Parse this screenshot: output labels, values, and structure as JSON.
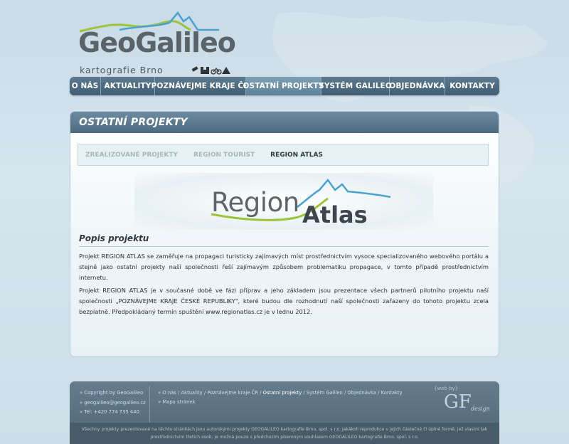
{
  "logo": {
    "name": "GeoGalileo",
    "subtitle": "kartografie Brno"
  },
  "nav": {
    "items": [
      {
        "label": "O NÁS"
      },
      {
        "label": "AKTUALITY"
      },
      {
        "label": "POZNÁVEJME KRAJE ČR"
      },
      {
        "label": "OSTATNÍ PROJEKTY",
        "active": true
      },
      {
        "label": "SYSTÉM GALILEO"
      },
      {
        "label": "OBJEDNÁVKA"
      },
      {
        "label": "KONTAKTY"
      }
    ]
  },
  "main": {
    "title": "OSTATNÍ PROJEKTY",
    "subtabs": [
      {
        "label": "ZREALIZOVANÉ PROJEKTY"
      },
      {
        "label": "REGION TOURIST"
      },
      {
        "label": "REGION ATLAS",
        "active": true
      }
    ],
    "banner": {
      "word1": "Region",
      "word2": "Atlas"
    },
    "section_title": "Popis projektu",
    "paragraph1": "Projekt REGION ATLAS se zaměřuje na propagaci turisticky zajímavých míst prostřednictvím vysoce specializovaného webového portálu a stejně jako ostatní projekty naší společnosti řeší zajímavým způsobem problematiku propagace, v tomto případě prostřednictvím internetu.",
    "paragraph2": "Projekt REGION ATLAS je v současné době ve fázi příprav a jeho základem jsou prezentace všech partnerů pilotního projektu naší společnosti „POZNÁVEJME KRAJE ČESKÉ REPUBLIKY\", které budou dle rozhodnutí naší společnosti zařazeny do tohoto projektu zcela bezplatně. Předpokládaný termín spuštění www.regionatlas.cz je v lednu 2012."
  },
  "footer": {
    "copyright": "» Copyright by GeoGalileo",
    "email": "» geogalileo@geogalileo.cz",
    "phone": "» Tel: +420 774 735 440",
    "links": [
      "O nás",
      "Aktuality",
      "Poznávejme kraje ČR",
      "Ostatní projekty",
      "Systém Galileo",
      "Objednávka",
      "Kontakty"
    ],
    "sitemap": "Mapa stránek",
    "webby_small": "{web by}",
    "webby_gf": "GF",
    "webby_design": "design",
    "legal_line1": "Všechny projekty prezentované na těchto stránkách jsou autorskými projekty GEOGALILEO kartografie Brno, spol. s r.o. Jakákoli reprodukce v jejich částečné či úplné formě, jež vlastní tak",
    "legal_line2": "prostřednictvím třetích osob, je možná pouze s předchozím písemným souhlasem GEOGALILEO kartografie Brno, spol. s r.o."
  },
  "colors": {
    "nav_bg": "#4b6b81",
    "logo_green": "#9cc33c",
    "logo_blue": "#4aa3cf"
  }
}
